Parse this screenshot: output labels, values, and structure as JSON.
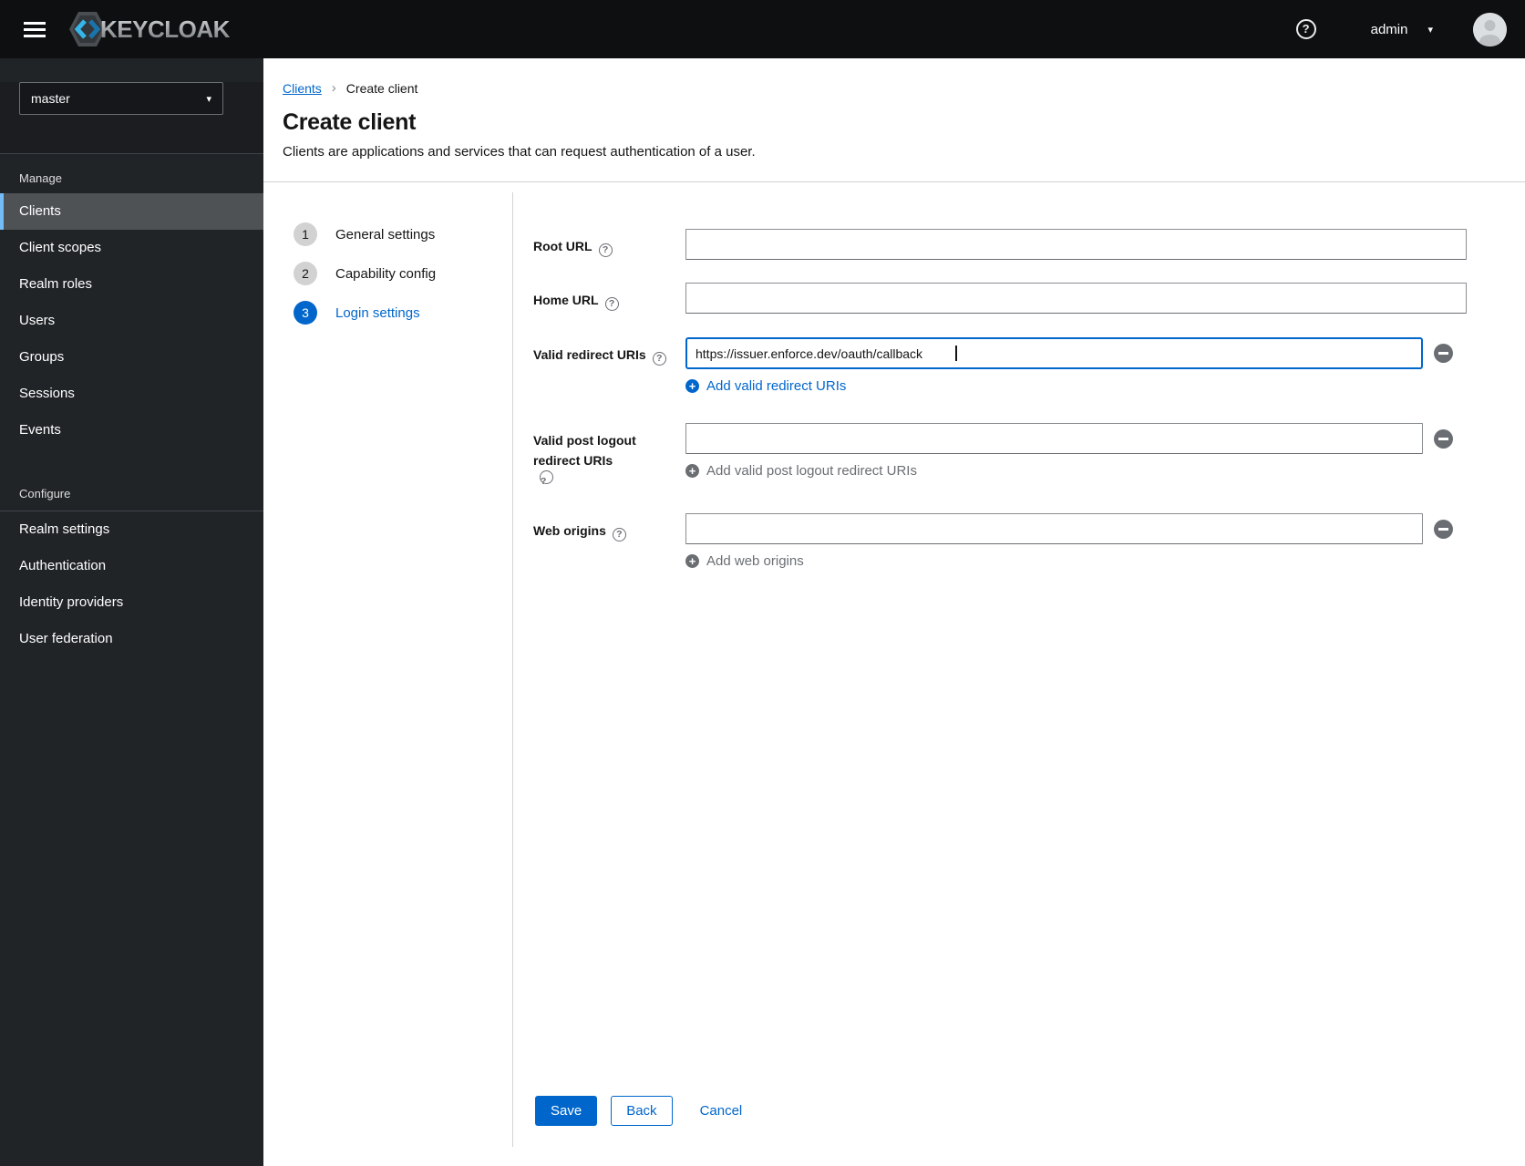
{
  "masthead": {
    "brand": "KEYCLOAK",
    "username": "admin"
  },
  "sidebar": {
    "realm": "master",
    "sections": [
      {
        "label": "Manage",
        "items": [
          {
            "label": "Clients",
            "selected": true
          },
          {
            "label": "Client scopes",
            "selected": false
          },
          {
            "label": "Realm roles",
            "selected": false
          },
          {
            "label": "Users",
            "selected": false
          },
          {
            "label": "Groups",
            "selected": false
          },
          {
            "label": "Sessions",
            "selected": false
          },
          {
            "label": "Events",
            "selected": false
          }
        ]
      },
      {
        "label": "Configure",
        "items": [
          {
            "label": "Realm settings",
            "selected": false
          },
          {
            "label": "Authentication",
            "selected": false
          },
          {
            "label": "Identity providers",
            "selected": false
          },
          {
            "label": "User federation",
            "selected": false
          }
        ]
      }
    ]
  },
  "breadcrumb": {
    "items": [
      {
        "label": "Clients"
      },
      {
        "label": "Create client"
      }
    ]
  },
  "page": {
    "title": "Create client",
    "subtitle": "Clients are applications and services that can request authentication of a user."
  },
  "wizard": {
    "steps": [
      {
        "num": "1",
        "label": "General settings",
        "active": false
      },
      {
        "num": "2",
        "label": "Capability config",
        "active": false
      },
      {
        "num": "3",
        "label": "Login settings",
        "active": true
      }
    ]
  },
  "form": {
    "fields": [
      {
        "label": "Root URL",
        "value": ""
      },
      {
        "label": "Home URL",
        "value": ""
      },
      {
        "label": "Valid redirect URIs",
        "value": "https://issuer.enforce.dev/oauth/callback",
        "focused": true,
        "add_label": "Add valid redirect URIs",
        "add_enabled": true
      },
      {
        "label_line1": "Valid post logout",
        "label_line2": "redirect URIs",
        "value": "",
        "add_label": "Add valid post logout redirect URIs",
        "add_enabled": false
      },
      {
        "label": "Web origins",
        "value": "",
        "add_label": "Add web origins",
        "add_enabled": false
      }
    ]
  },
  "actions": {
    "save": "Save",
    "back": "Back",
    "cancel": "Cancel"
  },
  "icons": {
    "help": "?",
    "field_help": "?",
    "caret": "▾",
    "breadcrumb_separator": "›",
    "plus": "+"
  },
  "colors": {
    "accent": "#0066cc",
    "masthead_bg": "#0d0f10",
    "sidebar_bg": "#212427",
    "sidebar_selected_bg": "#4f5255",
    "sidebar_selected_border": "#73bcf7",
    "muted": "#6a6e73",
    "divider": "#d2d2d2",
    "text": "#151515"
  }
}
